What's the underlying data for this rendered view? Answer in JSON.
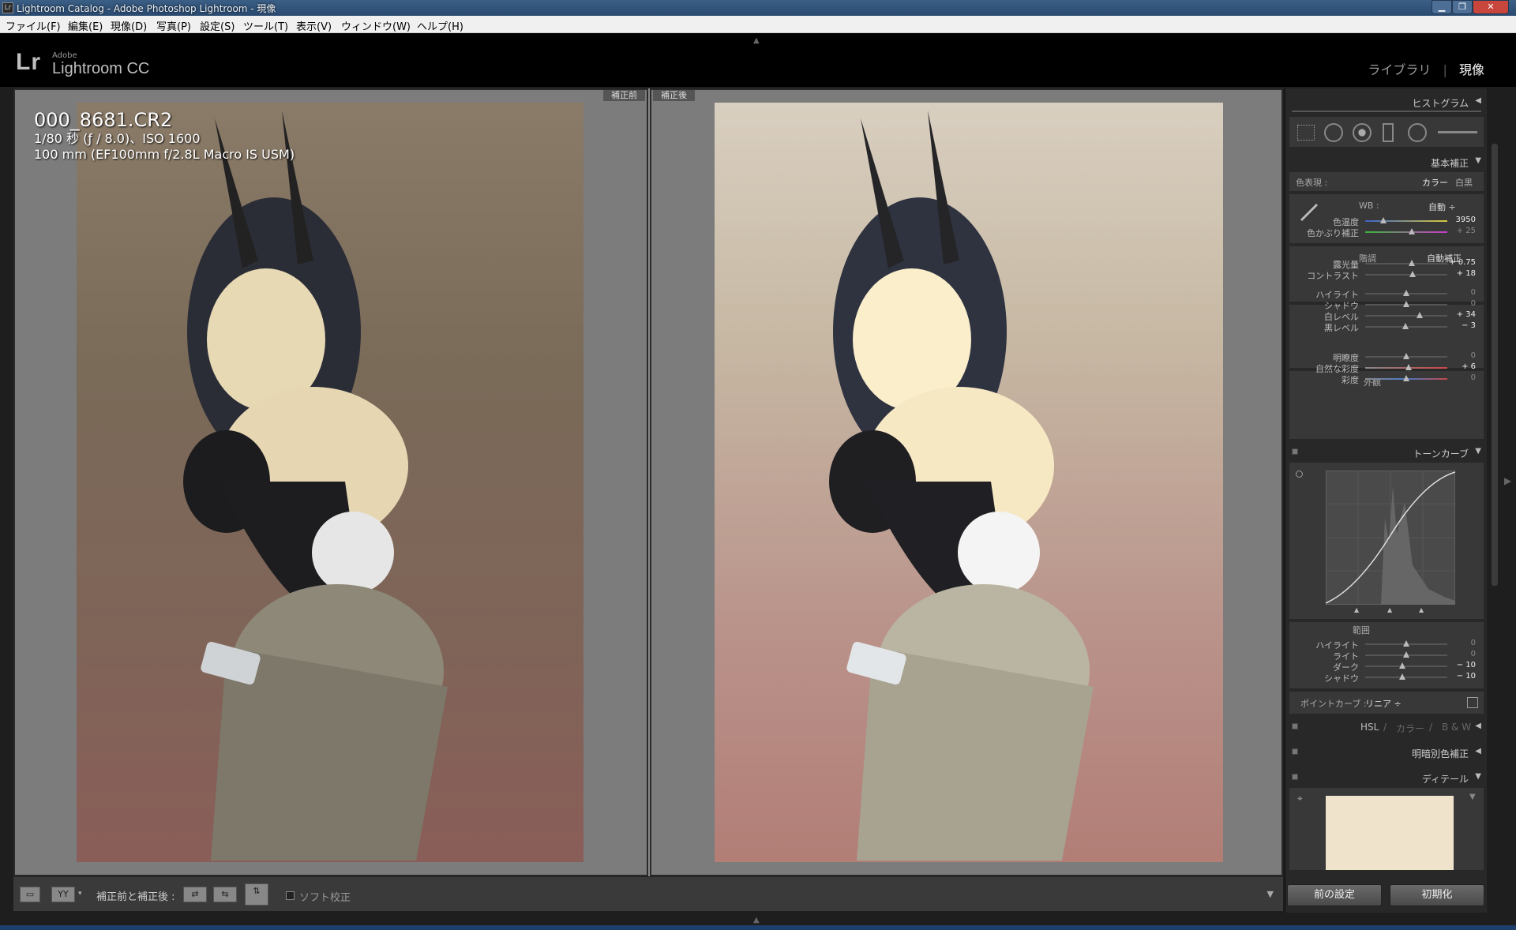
{
  "window": {
    "title": "Lightroom Catalog - Adobe Photoshop Lightroom - 現像"
  },
  "menu": [
    "ファイル(F)",
    "編集(E)",
    "現像(D)",
    "写真(P)",
    "設定(S)",
    "ツール(T)",
    "表示(V)",
    "ウィンドウ(W)",
    "ヘルプ(H)"
  ],
  "header": {
    "lr": "Lr",
    "adobe": "Adobe",
    "product": "Lightroom CC",
    "module_library": "ライブラリ",
    "separator": "|",
    "module_develop": "現像"
  },
  "viewer": {
    "before_tag": "補正前",
    "after_tag": "補正後",
    "file_name": "000_8681.CR2",
    "exposure_info": "1/80 秒 (ƒ / 8.0)、ISO 1600",
    "lens_info": "100 mm (EF100mm f/2.8L Macro IS USM)"
  },
  "toolbar": {
    "view_label": "YY",
    "before_after_label": "補正前と補正後 :",
    "soft_proof_label": "ソフト校正"
  },
  "panels": {
    "histogram": "ヒストグラム",
    "basic": "基本補正",
    "treatment_label": "色表現 :",
    "treatment_color": "カラー",
    "treatment_bw": "白黒",
    "wb_label": "WB :",
    "wb_value": "自動 ÷",
    "tone_label": "階調",
    "auto_tone": "自動補正",
    "presence_label": "外観",
    "tone_curve": "トーンカーブ",
    "region_label": "範囲",
    "point_curve_label": "ポイントカーブ :",
    "point_curve_value": "リニア ÷",
    "hsl": "HSL",
    "hsl_color": "カラー",
    "hsl_bw": "B & W",
    "split_toning": "明暗別色補正",
    "detail": "ディテール"
  },
  "basic_sliders": [
    {
      "label": "色温度",
      "value": "3950",
      "pos": 0.22,
      "active": true
    },
    {
      "label": "色かぶり補正",
      "value": "+ 25",
      "pos": 0.57,
      "active": false
    },
    {
      "label": "露光量",
      "value": "+ 0.75",
      "pos": 0.57,
      "active": true
    },
    {
      "label": "コントラスト",
      "value": "+ 18",
      "pos": 0.58,
      "active": true
    },
    {
      "label": "ハイライト",
      "value": "0",
      "pos": 0.5,
      "active": false
    },
    {
      "label": "シャドウ",
      "value": "0",
      "pos": 0.5,
      "active": false
    },
    {
      "label": "白レベル",
      "value": "+ 34",
      "pos": 0.66,
      "active": true
    },
    {
      "label": "黒レベル",
      "value": "− 3",
      "pos": 0.49,
      "active": true
    },
    {
      "label": "明瞭度",
      "value": "0",
      "pos": 0.5,
      "active": false
    },
    {
      "label": "自然な彩度",
      "value": "+ 6",
      "pos": 0.53,
      "active": true
    },
    {
      "label": "彩度",
      "value": "0",
      "pos": 0.5,
      "active": false
    }
  ],
  "curve_sliders": [
    {
      "label": "ハイライト",
      "value": "0",
      "pos": 0.5,
      "active": false
    },
    {
      "label": "ライト",
      "value": "0",
      "pos": 0.5,
      "active": false
    },
    {
      "label": "ダーク",
      "value": "− 10",
      "pos": 0.45,
      "active": true
    },
    {
      "label": "シャドウ",
      "value": "− 10",
      "pos": 0.45,
      "active": true
    }
  ],
  "footer": {
    "previous": "前の設定",
    "reset": "初期化"
  }
}
